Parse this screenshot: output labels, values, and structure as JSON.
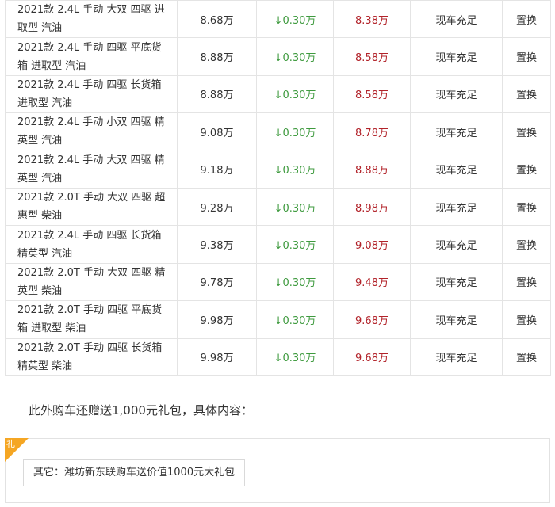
{
  "colors": {
    "drop": "#3e9a3e",
    "deal": "#b2232a",
    "gift_corner": "#f5a623"
  },
  "rows": [
    {
      "model": "2021款 2.4L 手动 大双 四驱 进取型 汽油",
      "guide": "8.68万",
      "drop": "0.30万",
      "deal": "8.38万",
      "stock": "现车充足",
      "trade": "置换"
    },
    {
      "model": "2021款 2.4L 手动 四驱 平底货箱 进取型 汽油",
      "guide": "8.88万",
      "drop": "0.30万",
      "deal": "8.58万",
      "stock": "现车充足",
      "trade": "置换"
    },
    {
      "model": "2021款 2.4L 手动 四驱 长货箱进取型 汽油",
      "guide": "8.88万",
      "drop": "0.30万",
      "deal": "8.58万",
      "stock": "现车充足",
      "trade": "置换"
    },
    {
      "model": "2021款 2.4L 手动 小双 四驱 精英型 汽油",
      "guide": "9.08万",
      "drop": "0.30万",
      "deal": "8.78万",
      "stock": "现车充足",
      "trade": "置换"
    },
    {
      "model": "2021款 2.4L 手动 大双 四驱 精英型 汽油",
      "guide": "9.18万",
      "drop": "0.30万",
      "deal": "8.88万",
      "stock": "现车充足",
      "trade": "置换"
    },
    {
      "model": "2021款 2.0T 手动 大双 四驱 超惠型 柴油",
      "guide": "9.28万",
      "drop": "0.30万",
      "deal": "8.98万",
      "stock": "现车充足",
      "trade": "置换"
    },
    {
      "model": "2021款 2.4L 手动 四驱 长货箱精英型 汽油",
      "guide": "9.38万",
      "drop": "0.30万",
      "deal": "9.08万",
      "stock": "现车充足",
      "trade": "置换"
    },
    {
      "model": "2021款 2.0T 手动 大双 四驱 精英型 柴油",
      "guide": "9.78万",
      "drop": "0.30万",
      "deal": "9.48万",
      "stock": "现车充足",
      "trade": "置换"
    },
    {
      "model": "2021款 2.0T 手动 四驱 平底货箱 进取型 柴油",
      "guide": "9.98万",
      "drop": "0.30万",
      "deal": "9.68万",
      "stock": "现车充足",
      "trade": "置换"
    },
    {
      "model": "2021款 2.0T 手动 四驱 长货箱精英型 柴油",
      "guide": "9.98万",
      "drop": "0.30万",
      "deal": "9.68万",
      "stock": "现车充足",
      "trade": "置换"
    }
  ],
  "gift": {
    "intro": "此外购车还赠送1,000元礼包，具体内容：",
    "corner_label": "礼",
    "item": "其它：潍坊新东联购车送价值1000元大礼包"
  }
}
